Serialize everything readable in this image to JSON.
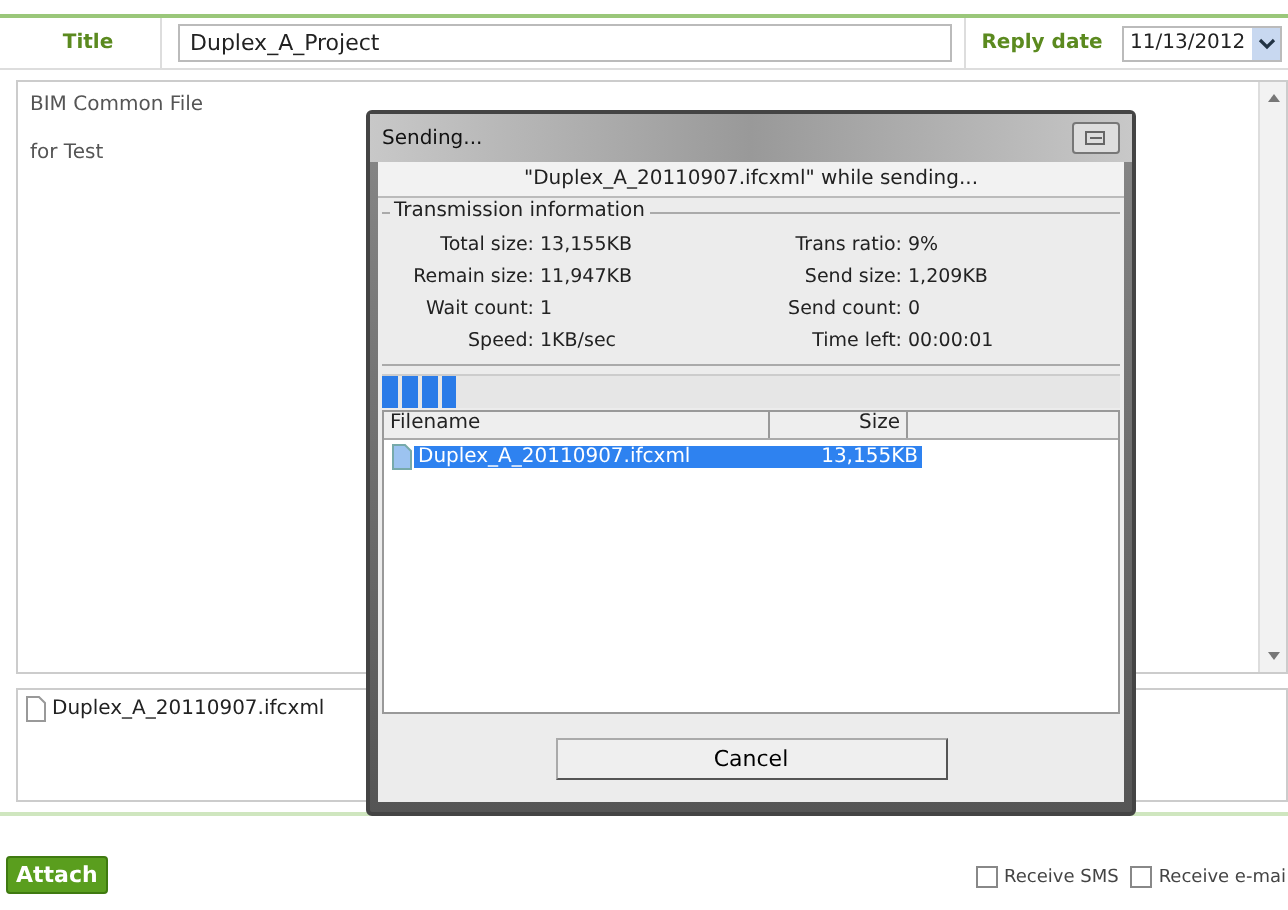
{
  "form": {
    "title_label": "Title",
    "title_value": "Duplex_A_Project",
    "reply_date_label": "Reply date",
    "reply_date": "11/13/2012",
    "body_lines": [
      "BIM Common File",
      "for Test"
    ],
    "attachments": [
      "Duplex_A_20110907.ifcxml"
    ],
    "attach_button": "Attach",
    "options": [
      {
        "label": "Receive SMS",
        "checked": false
      },
      {
        "label": "Receive e-mai",
        "checked": false
      }
    ]
  },
  "dialog": {
    "title": "Sending...",
    "message": "\"Duplex_A_20110907.ifcxml\" while sending...",
    "group_title": "Transmission information",
    "stats": [
      {
        "label": "Total size:",
        "value": "13,155KB"
      },
      {
        "label": "Trans ratio:",
        "value": "9%"
      },
      {
        "label": "Remain size:",
        "value": "11,947KB"
      },
      {
        "label": "Send size:",
        "value": "1,209KB"
      },
      {
        "label": "Wait count:",
        "value": "1"
      },
      {
        "label": "Send count:",
        "value": "0"
      },
      {
        "label": "Speed:",
        "value": "1KB/sec"
      },
      {
        "label": "Time left:",
        "value": "00:00:01"
      }
    ],
    "progress": {
      "level": 0.1
    },
    "columns": [
      "Filename",
      "Size"
    ],
    "files": [
      {
        "name": "Duplex_A_20110907.ifcxml",
        "size": "13,155KB",
        "selected": true
      }
    ],
    "cancel_button": "Cancel"
  }
}
